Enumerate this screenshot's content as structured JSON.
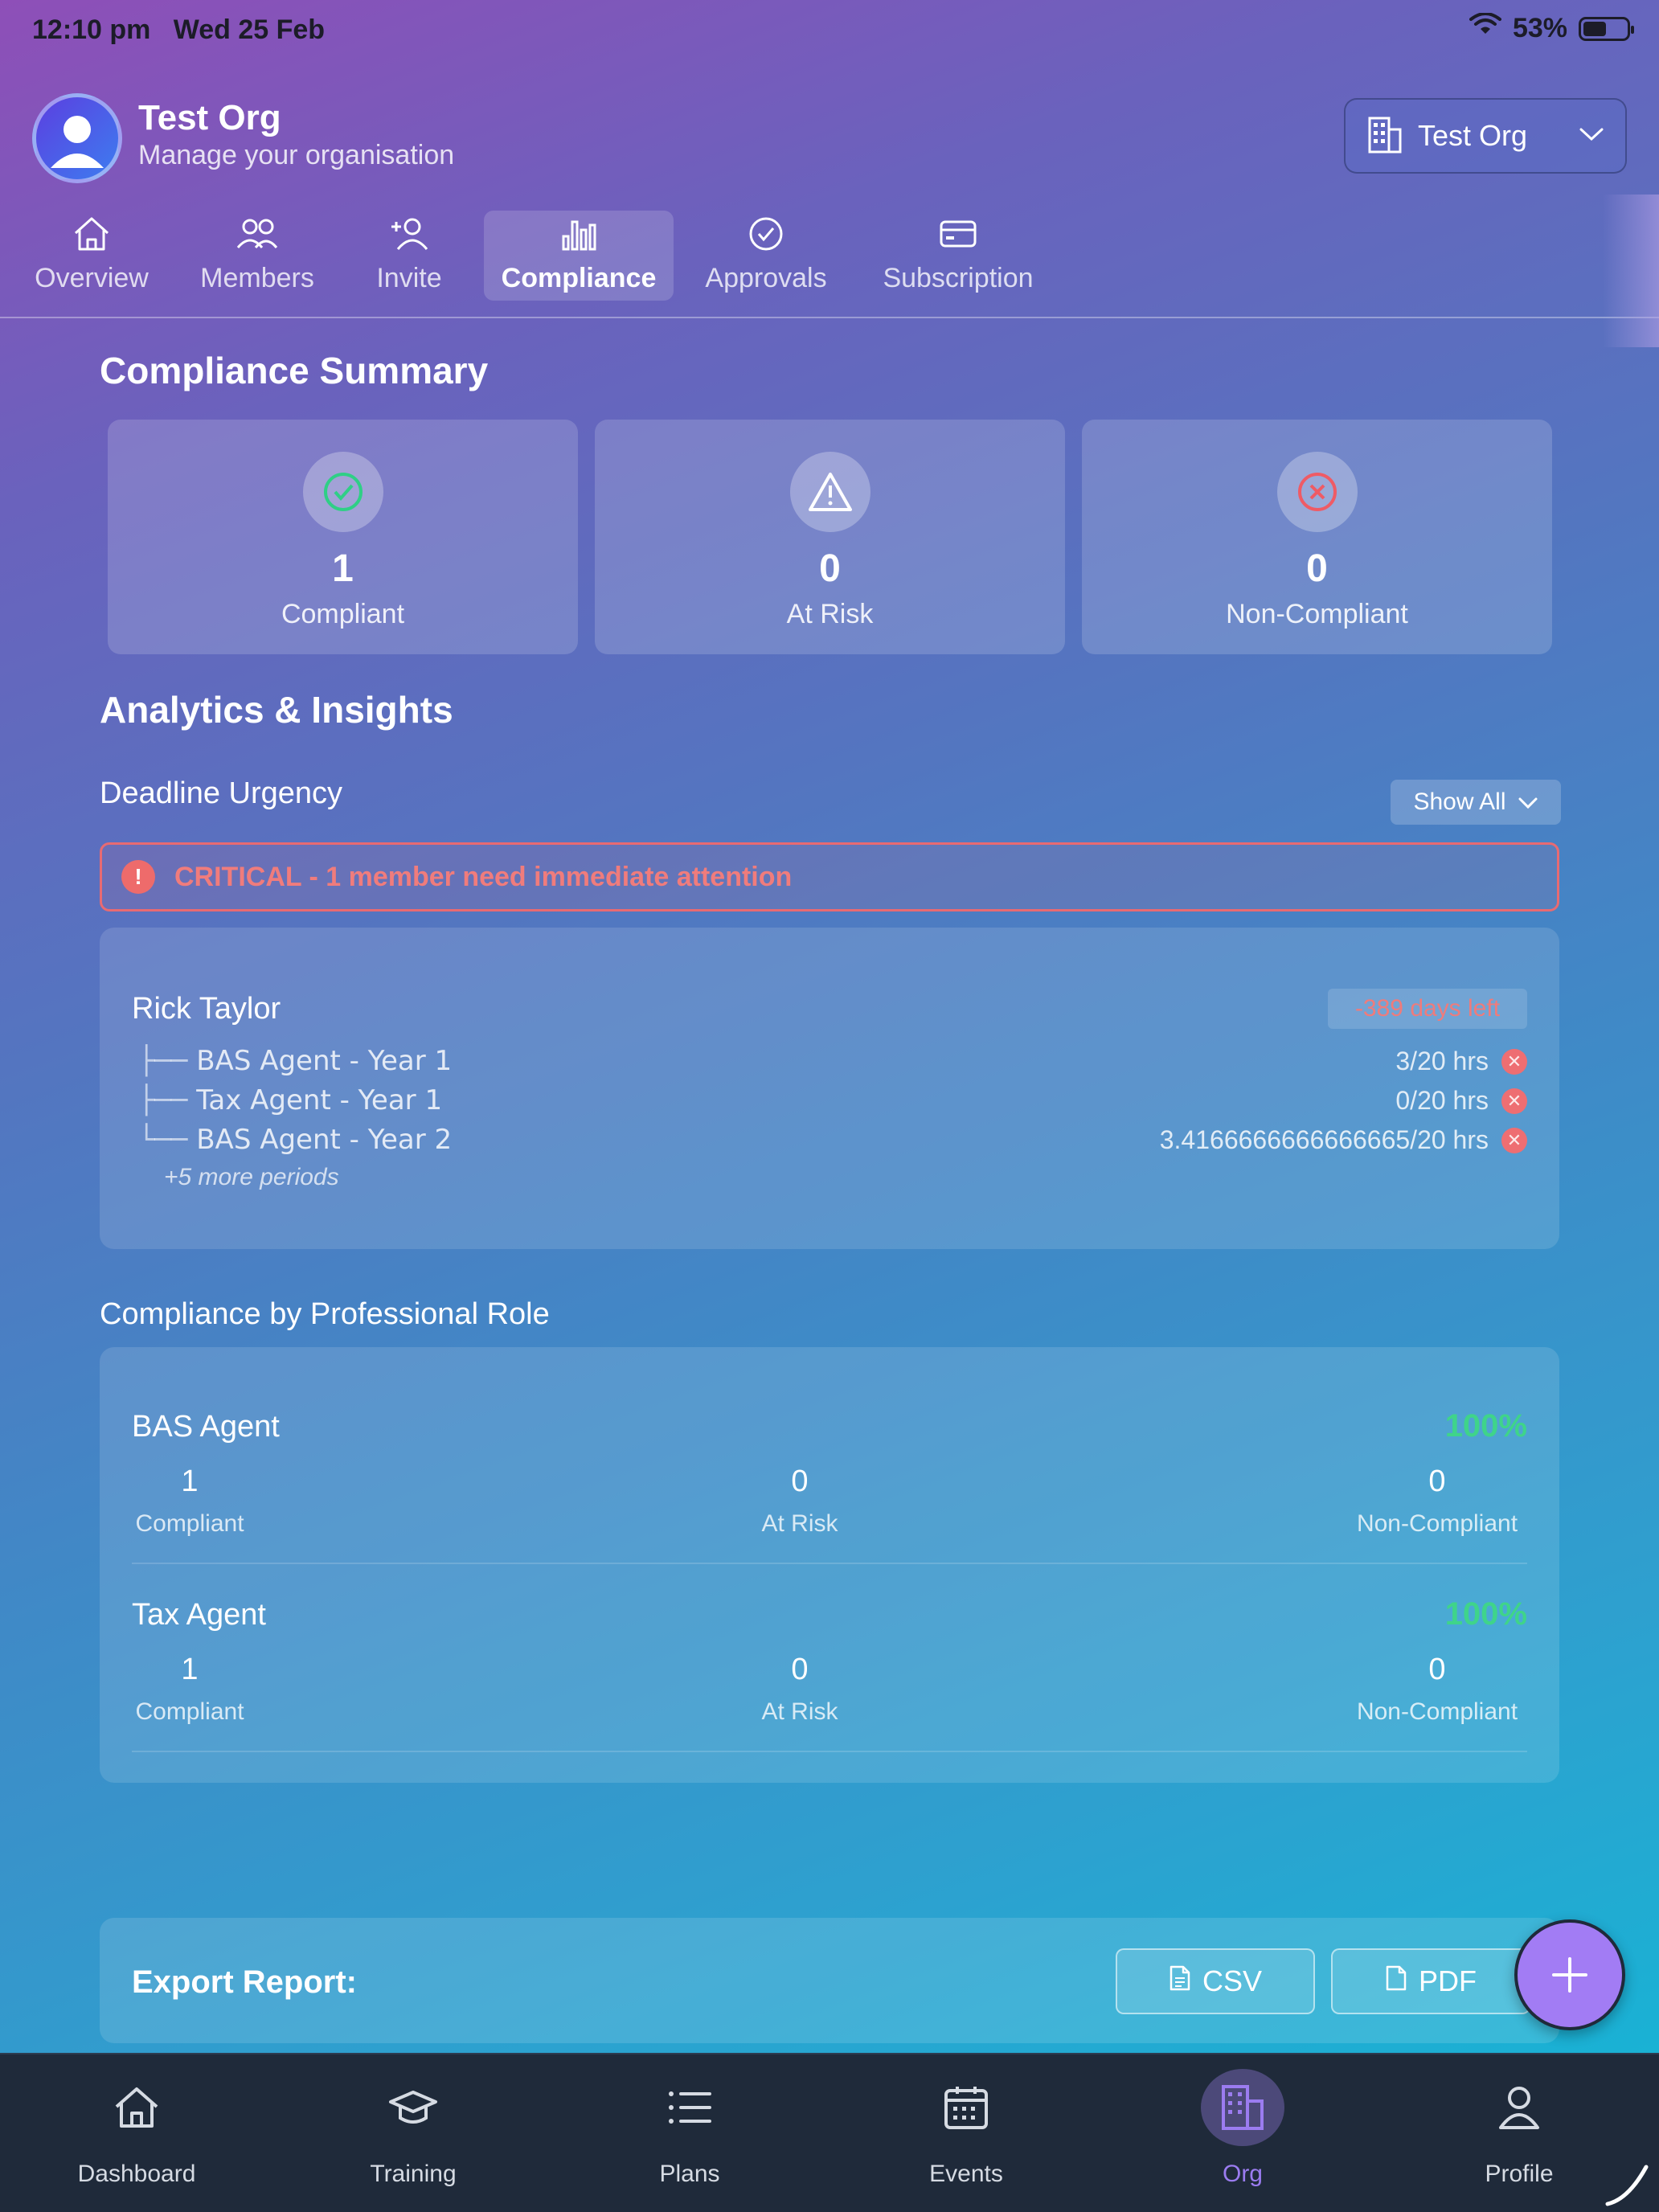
{
  "status_bar": {
    "time": "12:10 pm",
    "date": "Wed 25 Feb",
    "battery": "53%",
    "battery_level": 0.53
  },
  "header": {
    "title": "Test Org",
    "subtitle": "Manage your organisation",
    "org_selector": "Test Org"
  },
  "tabs": [
    {
      "label": "Overview",
      "icon": "home-icon"
    },
    {
      "label": "Members",
      "icon": "members-icon"
    },
    {
      "label": "Invite",
      "icon": "add-user-icon"
    },
    {
      "label": "Compliance",
      "icon": "bar-chart-icon",
      "active": true
    },
    {
      "label": "Approvals",
      "icon": "check-circle-icon"
    },
    {
      "label": "Subscription",
      "icon": "credit-card-icon"
    }
  ],
  "summary": {
    "heading": "Compliance Summary",
    "cards": [
      {
        "value": "1",
        "label": "Compliant",
        "icon": "check-circle-icon",
        "color": "#2fcf86"
      },
      {
        "value": "0",
        "label": "At Risk",
        "icon": "warning-icon",
        "color": "#ffffff"
      },
      {
        "value": "0",
        "label": "Non-Compliant",
        "icon": "x-circle-icon",
        "color": "#ef5b65"
      }
    ]
  },
  "analytics": {
    "heading": "Analytics & Insights",
    "deadline": {
      "heading": "Deadline Urgency",
      "filter": "Show All",
      "alert": "CRITICAL - 1 member need immediate attention",
      "member": {
        "name": "Rick Taylor",
        "days_left": "-389 days left",
        "periods": [
          {
            "tree": "├──",
            "name": "BAS Agent - Year 1",
            "hours": "3/20 hrs"
          },
          {
            "tree": "├──",
            "name": "Tax Agent - Year 1",
            "hours": "0/20 hrs"
          },
          {
            "tree": "└──",
            "name": "BAS Agent - Year 2",
            "hours": "3.4166666666666665/20 hrs"
          }
        ],
        "more": "+5 more periods"
      }
    },
    "roles": {
      "heading": "Compliance by Professional Role",
      "items": [
        {
          "name": "BAS Agent",
          "percent": "100%",
          "compliant": "1",
          "compliant_label": "Compliant",
          "at_risk": "0",
          "at_risk_label": "At Risk",
          "non_compliant": "0",
          "non_compliant_label": "Non-Compliant"
        },
        {
          "name": "Tax Agent",
          "percent": "100%",
          "compliant": "1",
          "compliant_label": "Compliant",
          "at_risk": "0",
          "at_risk_label": "At Risk",
          "non_compliant": "0",
          "non_compliant_label": "Non-Compliant"
        }
      ]
    }
  },
  "export": {
    "label": "Export Report:",
    "csv": "CSV",
    "pdf": "PDF"
  },
  "bottom_nav": [
    {
      "label": "Dashboard",
      "icon": "home-icon"
    },
    {
      "label": "Training",
      "icon": "graduation-cap-icon"
    },
    {
      "label": "Plans",
      "icon": "list-icon"
    },
    {
      "label": "Events",
      "icon": "calendar-icon"
    },
    {
      "label": "Org",
      "icon": "building-icon",
      "active": true
    },
    {
      "label": "Profile",
      "icon": "user-icon"
    }
  ],
  "colors": {
    "accent": "#9b7cf0",
    "success": "#3fd48a",
    "danger": "#ef6b6b",
    "nav_bg": "#1f2a3a"
  }
}
